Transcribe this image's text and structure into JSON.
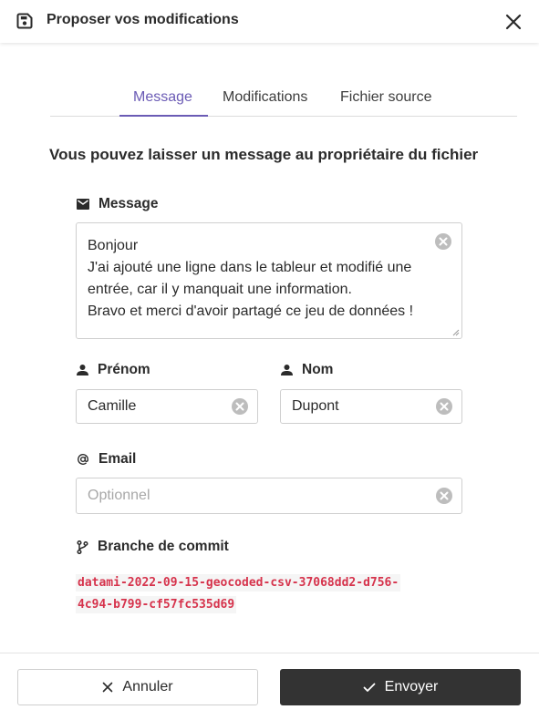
{
  "header": {
    "title": "Proposer vos modifications"
  },
  "tabs": [
    {
      "label": "Message",
      "active": true
    },
    {
      "label": "Modifications",
      "active": false
    },
    {
      "label": "Fichier source",
      "active": false
    }
  ],
  "subtitle": "Vous pouvez laisser un message au propriétaire du fichier",
  "form": {
    "message": {
      "label": "Message",
      "lines": [
        "Bonjour",
        "J'ai ajouté une ligne dans le tableur et modifié une",
        "entrée, car il y manquait une information.",
        "Bravo et merci d'avoir partagé ce jeu de données !"
      ]
    },
    "firstname": {
      "label": "Prénom",
      "value": "Camille"
    },
    "lastname": {
      "label": "Nom",
      "value": "Dupont"
    },
    "email": {
      "label": "Email",
      "value": "",
      "placeholder": "Optionnel"
    },
    "branch": {
      "label": "Branche de commit",
      "value_line1": "datami-2022-09-15-geocoded-csv-37068dd2-d756-",
      "value_line2": "4c94-b799-cf57fc535d69"
    }
  },
  "footer": {
    "cancel_label": "Annuler",
    "send_label": "Envoyer"
  },
  "colors": {
    "accent": "#6b5bb5",
    "code": "#d6334c",
    "primary_button": "#333333"
  },
  "icons": {
    "header": "save-icon",
    "close": "close-icon",
    "message": "mail-icon",
    "person": "person-icon",
    "email": "at-sign-icon",
    "branch": "git-branch-icon",
    "clear": "clear-circle-icon",
    "cancel": "x-icon",
    "send": "check-icon"
  }
}
